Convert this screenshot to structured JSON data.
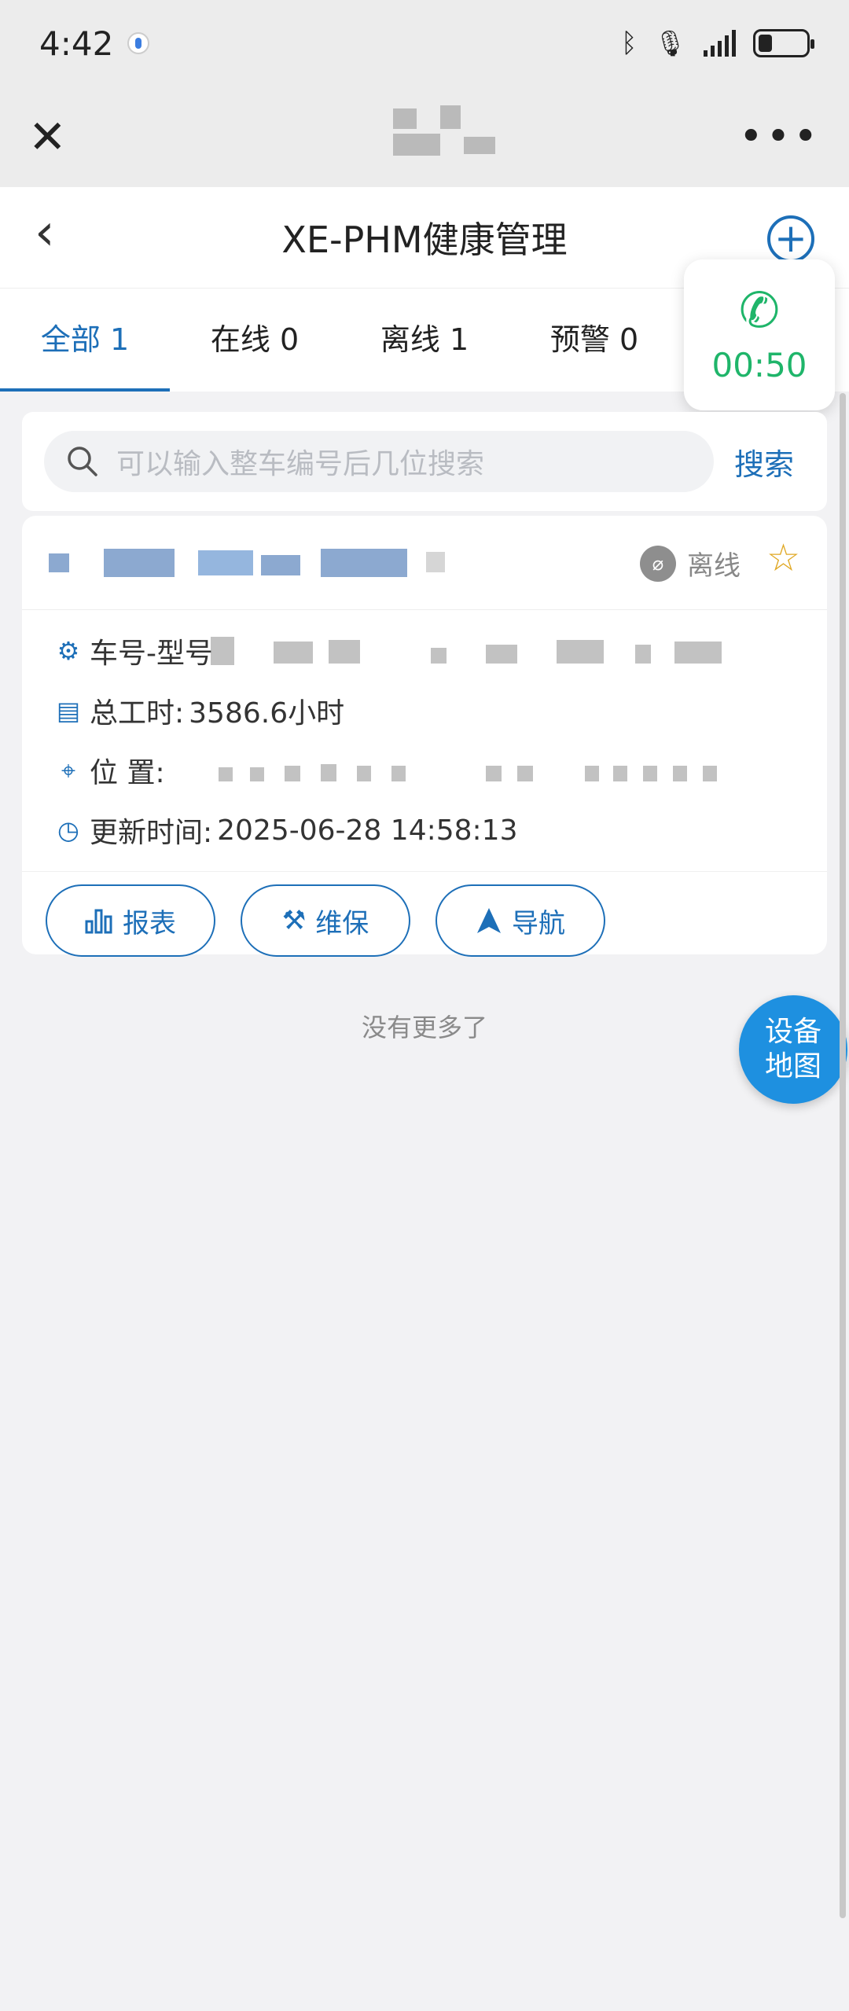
{
  "status_bar": {
    "time": "4:42"
  },
  "web_bar": {
    "close_icon": "close-icon",
    "more_icon": "more-dots-icon"
  },
  "nav": {
    "back_icon": "chevron-left-icon",
    "title": "XE-PHM健康管理",
    "add_icon": "plus-circle-icon"
  },
  "tabs": [
    {
      "label": "全部 1",
      "active": true
    },
    {
      "label": "在线 0",
      "active": false
    },
    {
      "label": "离线 1",
      "active": false
    },
    {
      "label": "预警 0",
      "active": false
    }
  ],
  "call_widget": {
    "icon": "phone-icon",
    "timer": "00:50",
    "color": "#1fb56a"
  },
  "search": {
    "placeholder": "可以输入整车编号后几位搜索",
    "button": "搜索"
  },
  "device_card": {
    "status": "离线",
    "rows": {
      "model_label": "车号-型号",
      "hours_label": "总工时:",
      "hours_value": "3586.6小时",
      "location_label": "位 置:",
      "update_label": "更新时间:",
      "update_value": "2025-06-28 14:58:13"
    },
    "actions": {
      "report": "报表",
      "maintenance": "维保",
      "navigate": "导航"
    }
  },
  "list_end": "没有更多了",
  "map_button": {
    "line1": "设备",
    "line2": "地图"
  },
  "colors": {
    "accent": "#1d6fb8",
    "map_button": "#1e90e0",
    "star": "#e0a824"
  }
}
